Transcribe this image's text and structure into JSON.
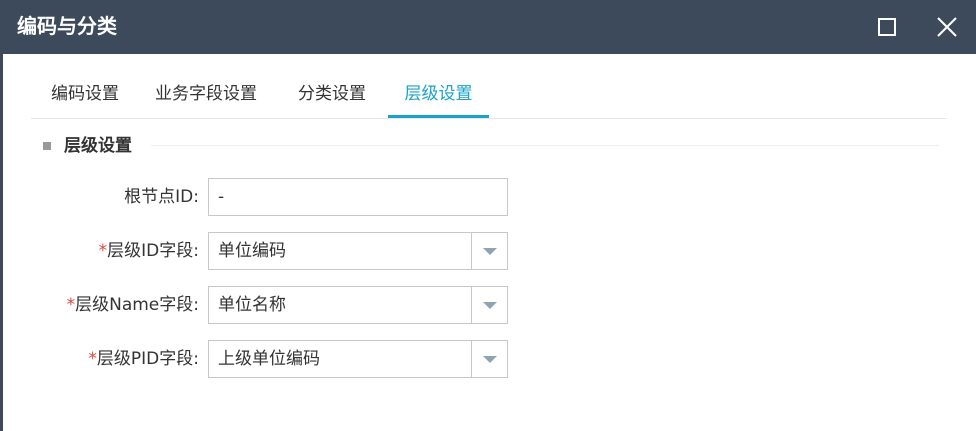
{
  "window": {
    "title": "编码与分类",
    "titlebar_color": "#3d4a5c",
    "controls": [
      "maximize-icon",
      "close-icon"
    ]
  },
  "tabs": [
    {
      "label": "编码设置",
      "active": false
    },
    {
      "label": "业务字段设置",
      "active": false
    },
    {
      "label": "分类设置",
      "active": false
    },
    {
      "label": "层级设置",
      "active": true
    }
  ],
  "accent_color": "#1aa3c7",
  "required_color": "#e0463c",
  "section": {
    "title": "层级设置"
  },
  "form": {
    "root_id": {
      "required_mark": "",
      "label": "根节点ID:",
      "value": "-"
    },
    "level_id": {
      "required_mark": "*",
      "label": "层级ID字段:",
      "value": "单位编码"
    },
    "level_name": {
      "required_mark": "*",
      "label": "层级Name字段:",
      "value": "单位名称"
    },
    "level_pid": {
      "required_mark": "*",
      "label": "层级PID字段:",
      "value": "上级单位编码"
    }
  }
}
